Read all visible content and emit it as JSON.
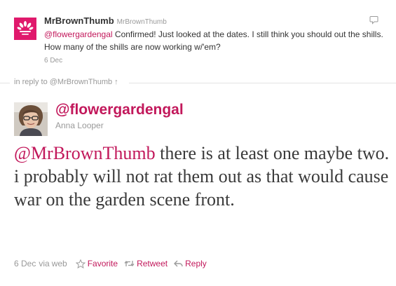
{
  "parent_tweet": {
    "display_name": "MrBrownThumb",
    "screen_name": "MrBrownThumb",
    "text_mention": "@flowergardengal",
    "text_body": " Confirmed! Just looked at the dates. I still think you should out the shills. How many of the shills are now working w/'em?",
    "date": "6 Dec",
    "avatar_color": "#e0196c"
  },
  "conversation": {
    "in_reply_to_label": "in reply to @MrBrownThumb",
    "arrow": "↑"
  },
  "main_tweet": {
    "screen_name": "@flowergardengal",
    "display_name": "Anna Looper",
    "text_mention": "@MrBrownThumb",
    "text_body": " there is at least one maybe two. i probably will not rat them out as that would cause war on the garden scene front.",
    "date": "6 Dec",
    "via_label": "via",
    "via_source": "web"
  },
  "actions": {
    "favorite": "Favorite",
    "retweet": "Retweet",
    "reply": "Reply"
  },
  "colors": {
    "link": "#c2185b",
    "muted": "#999999",
    "text": "#333333"
  }
}
